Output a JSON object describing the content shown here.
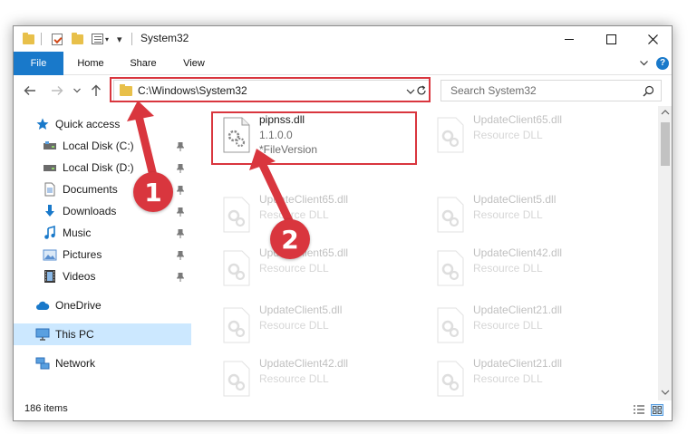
{
  "window": {
    "title": "System32",
    "controls": {
      "minimize": "minimize",
      "maximize": "maximize",
      "close": "close"
    }
  },
  "ribbon": {
    "tabs": [
      "File",
      "Home",
      "Share",
      "View"
    ],
    "help": "?"
  },
  "nav": {
    "address": "C:\\Windows\\System32",
    "search_placeholder": "Search System32"
  },
  "sidebar": {
    "items": [
      {
        "label": "Quick access",
        "icon": "star-icon",
        "pinned": false
      },
      {
        "label": "Local Disk (C:)",
        "icon": "drive-icon",
        "pinned": true
      },
      {
        "label": "Local Disk (D:)",
        "icon": "drive-icon",
        "pinned": true
      },
      {
        "label": "Documents",
        "icon": "document-icon",
        "pinned": true
      },
      {
        "label": "Downloads",
        "icon": "download-icon",
        "pinned": true
      },
      {
        "label": "Music",
        "icon": "music-icon",
        "pinned": true
      },
      {
        "label": "Pictures",
        "icon": "picture-icon",
        "pinned": true
      },
      {
        "label": "Videos",
        "icon": "video-icon",
        "pinned": true
      },
      {
        "label": "OneDrive",
        "icon": "cloud-icon",
        "pinned": false
      },
      {
        "label": "This PC",
        "icon": "computer-icon",
        "pinned": false,
        "selected": true
      },
      {
        "label": "Network",
        "icon": "network-icon",
        "pinned": false
      }
    ]
  },
  "files": {
    "left": [
      {
        "name": "pipnss.dll",
        "line2": "1.1.0.0",
        "line3": "*FileVersion",
        "highlighted": true
      },
      {
        "name": "UpdateClient65.dll",
        "line2": "Resource DLL"
      },
      {
        "name": "UpdateClient65.dll",
        "line2": "Resource DLL"
      },
      {
        "name": "UpdateClient5.dll",
        "line2": "Resource DLL"
      },
      {
        "name": "UpdateClient42.dll",
        "line2": "Resource DLL"
      }
    ],
    "right": [
      {
        "name": "UpdateClient65.dll",
        "line2": "Resource DLL"
      },
      {
        "name": "UpdateClient5.dll",
        "line2": "Resource DLL"
      },
      {
        "name": "UpdateClient42.dll",
        "line2": "Resource DLL"
      },
      {
        "name": "UpdateClient21.dll",
        "line2": "Resource DLL"
      },
      {
        "name": "UpdateClient21.dll",
        "line2": "Resource DLL"
      }
    ]
  },
  "status": {
    "item_count": "186 items"
  },
  "callouts": [
    "1",
    "2"
  ],
  "colors": {
    "accent": "#1979ca",
    "highlight": "#d9363e",
    "selection": "#cce8ff"
  }
}
